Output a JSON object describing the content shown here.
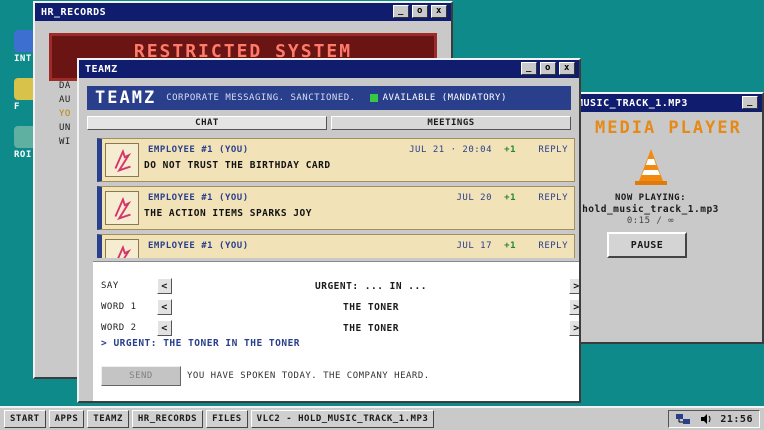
{
  "desktop": {
    "icons": [
      {
        "label": "INT",
        "color": "#3d6fd1"
      },
      {
        "label": "F",
        "color": "#d9c24a"
      },
      {
        "label": "ROI",
        "color": "#5fb0a0"
      }
    ]
  },
  "hr_window": {
    "title": "HR_RECORDS",
    "banner": "RESTRICTED SYSTEM",
    "lines": [
      "DA",
      "AU",
      "YO",
      "UN",
      "WI"
    ]
  },
  "teamz_window": {
    "title": "TEAMZ",
    "brand": "TEAMZ",
    "tagline": "CORPORATE MESSAGING. SANCTIONED.",
    "status": "AVAILABLE (MANDATORY)",
    "status_color": "#36c944",
    "tabs": [
      {
        "label": "CHAT"
      },
      {
        "label": "MEETINGS"
      }
    ],
    "messages": [
      {
        "author": "EMPLOYEE #1 (YOU)",
        "date": "JUL 21 · 20:04",
        "votes": "+1",
        "reply": "REPLY",
        "body": "DO NOT TRUST THE BIRTHDAY CARD"
      },
      {
        "author": "EMPLOYEE #1 (YOU)",
        "date": "JUL 20",
        "votes": "+1",
        "reply": "REPLY",
        "body": "THE ACTION ITEMS SPARKS JOY"
      },
      {
        "author": "EMPLOYEE #1 (YOU)",
        "date": "JUL 17",
        "votes": "+1",
        "reply": "REPLY",
        "body": ""
      }
    ],
    "composer": {
      "rows": [
        {
          "label": "SAY",
          "value": "URGENT: ... IN ..."
        },
        {
          "label": "WORD 1",
          "value": "THE TONER"
        },
        {
          "label": "WORD 2",
          "value": "THE TONER"
        }
      ],
      "prev_glyph": "<",
      "next_glyph": ">",
      "preview": "> URGENT: THE TONER IN THE TONER",
      "send_label": "SEND",
      "note": "YOU HAVE SPOKEN TODAY. THE COMPANY HEARD."
    }
  },
  "vlc_window": {
    "title": "MUSIC_TRACK_1.MP3",
    "heading": "MEDIA PLAYER",
    "now_playing_label": "NOW PLAYING:",
    "track": "hold_music_track_1.mp3",
    "time": "0:15 / ∞",
    "pause_label": "PAUSE"
  },
  "window_controls": {
    "minimize": "_",
    "maximize": "o",
    "close": "x"
  },
  "taskbar": {
    "buttons": [
      "START",
      "APPS",
      "TEAMZ",
      "HR_RECORDS",
      "FILES",
      "VLC2 - HOLD_MUSIC_TRACK_1.MP3"
    ],
    "clock": "21:56"
  }
}
